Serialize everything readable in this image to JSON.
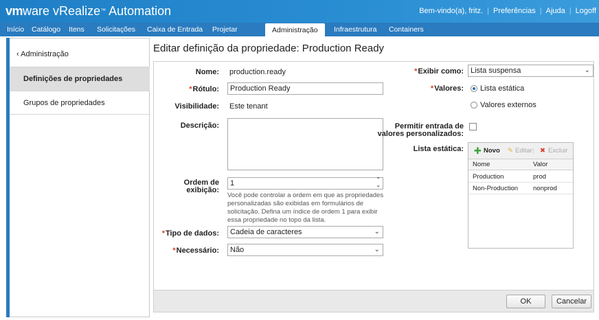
{
  "header": {
    "logo_vm": "vm",
    "logo_ware": "ware",
    "product": "vRealize",
    "product2": "Automation",
    "welcome": "Bem-vindo(a), fritz.",
    "prefs": "Preferências",
    "help": "Ajuda",
    "logoff": "Logoff"
  },
  "nav": {
    "tabs": [
      "Início",
      "Catálogo",
      "Itens",
      "Solicitações",
      "Caixa de Entrada",
      "Projetar",
      "Administração",
      "Infraestrutura",
      "Containers"
    ],
    "active": "Administração"
  },
  "sidebar": {
    "back": "Administração",
    "items": [
      "Definições de propriedades",
      "Grupos de propriedades"
    ]
  },
  "page": {
    "title": "Editar definição da propriedade: Production Ready"
  },
  "form": {
    "name_label": "Nome:",
    "name_value": "production.ready",
    "label_label": "Rótulo:",
    "label_value": "Production Ready",
    "visibility_label": "Visibilidade:",
    "visibility_value": "Este tenant",
    "description_label": "Descrição:",
    "description_value": "",
    "order_label_1": "Ordem de",
    "order_label_2": "exibição:",
    "order_value": "1",
    "order_help": "Você pode controlar a ordem em que as propriedades personalizadas são exibidas em formulários de solicitação. Defina um índice de ordem 1 para exibir essa propriedade no topo da lista.",
    "datatype_label": "Tipo de dados:",
    "datatype_value": "Cadeia de caracteres",
    "required_label": "Necessário:",
    "required_value": "Não",
    "display_label": "Exibir como:",
    "display_value": "Lista suspensa",
    "values_label": "Valores:",
    "values_options": [
      "Lista estática",
      "Valores externos"
    ],
    "custom_label_1": "Permitir entrada de",
    "custom_label_2": "valores personalizados:",
    "static_list_label": "Lista estática:",
    "required_mark": "*"
  },
  "static_list": {
    "new": "Novo",
    "edit": "Editar",
    "delete": "Excluir",
    "columns": [
      "Nome",
      "Valor"
    ],
    "rows": [
      {
        "name": "Production",
        "value": "prod"
      },
      {
        "name": "Non-Production",
        "value": "nonprod"
      }
    ]
  },
  "footer": {
    "ok": "OK",
    "cancel": "Cancelar"
  },
  "colors": {
    "header_blue": "#1f7fc6",
    "nav_blue": "#2a7bbf",
    "required_red": "#d9412b",
    "add_green": "#3aa33a",
    "delete_red": "#d9412b"
  }
}
